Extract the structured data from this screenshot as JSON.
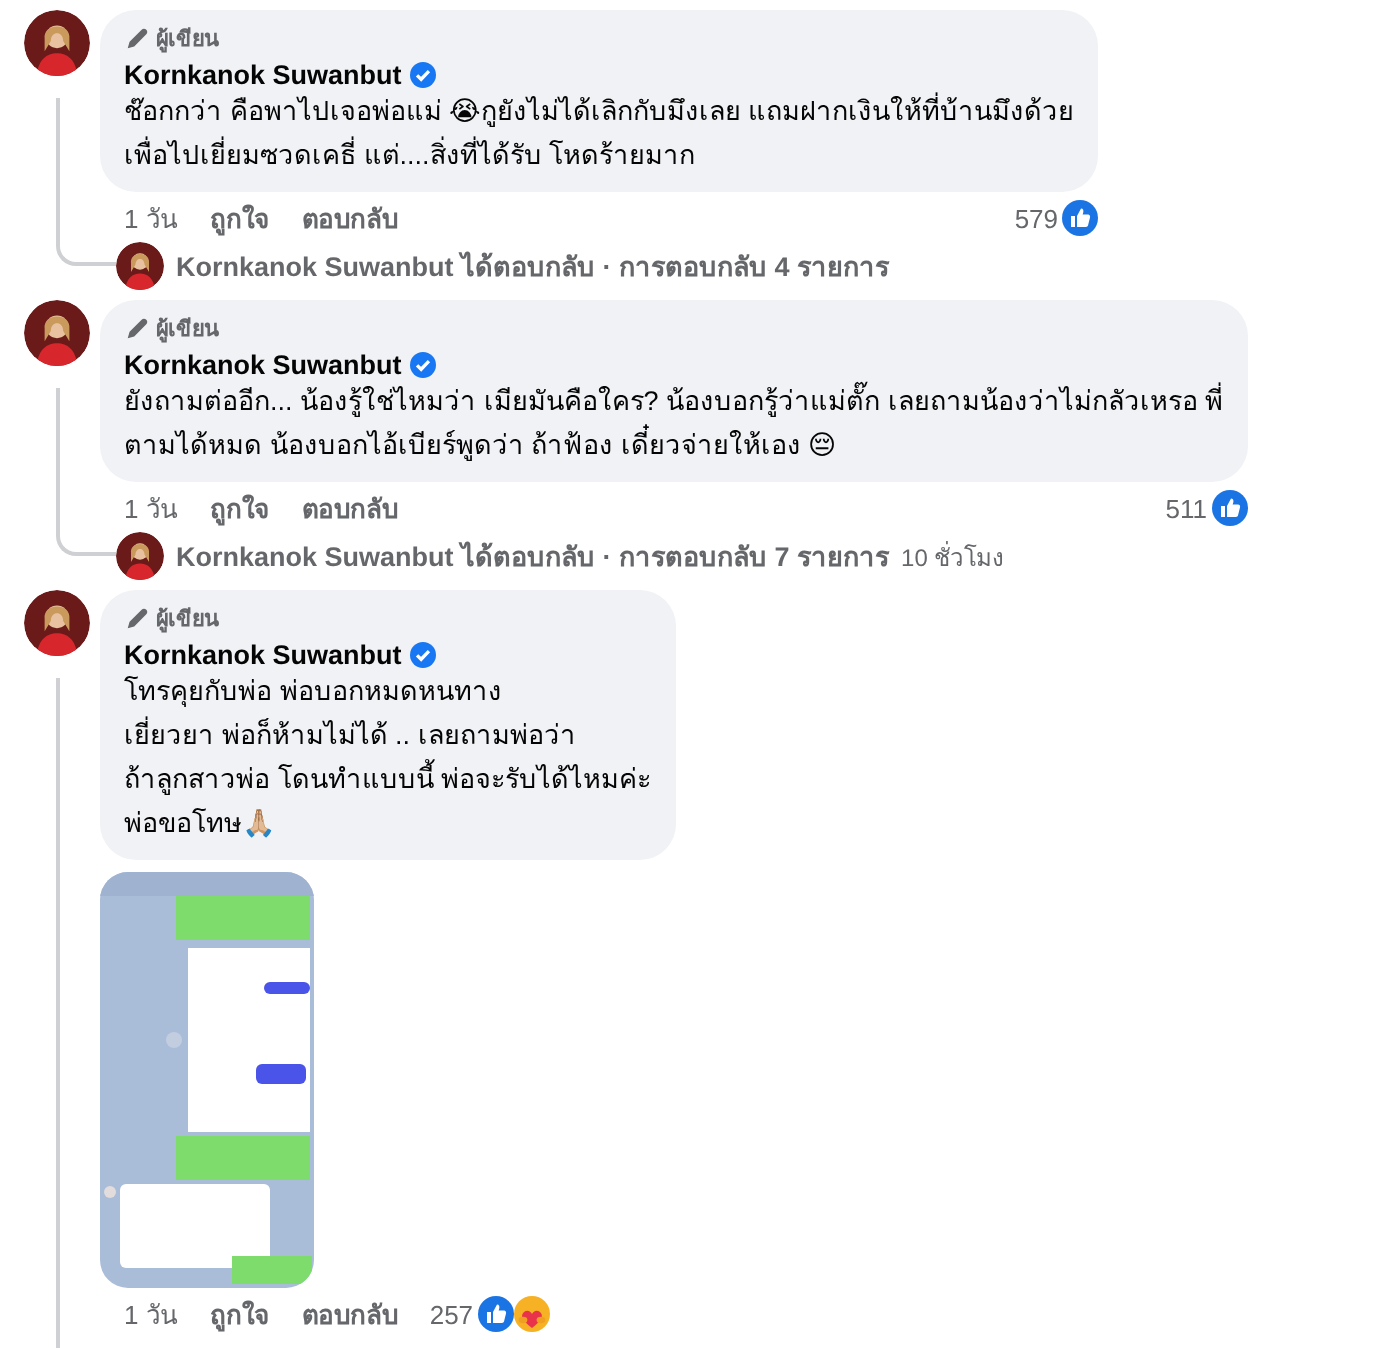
{
  "comments": [
    {
      "badge": "ผู้เขียน",
      "author": "Kornkanok Suwanbut",
      "verified": true,
      "text": "ช๊อกกว่า คือพาไปเจอพ่อแม่ 😭กูยังไม่ได้เลิกกับมึงเลย แถมฝากเงินให้ที่บ้านมึงด้วย\nเพื่อไปเยี่ยมซวดเคธี่ แต่....สิ่งที่ได้รับ โหดร้ายมาก",
      "time": "1 วัน",
      "like": "ถูกใจ",
      "reply": "ตอบกลับ",
      "reaction_count": "579",
      "reactions": [
        {
          "kind": "like"
        }
      ],
      "replies_summary": {
        "author": "Kornkanok Suwanbut",
        "text": "ได้ตอบกลับ · การตอบกลับ 4 รายการ"
      }
    },
    {
      "badge": "ผู้เขียน",
      "author": "Kornkanok Suwanbut",
      "verified": true,
      "text": "ยังถามต่ออีก... น้องรู้ใช่ไหมว่า เมียมันคือใคร? น้องบอกรู้ว่าแม่ตั๊ก เลยถามน้องว่าไม่กลัวเหรอ พี่\nตามได้หมด น้องบอกไอ้เบียร์พูดว่า ถ้าฟ้อง เดี๋ยวจ่ายให้เอง 😔",
      "time": "1 วัน",
      "like": "ถูกใจ",
      "reply": "ตอบกลับ",
      "reaction_count": "511",
      "reactions": [
        {
          "kind": "like"
        }
      ],
      "replies_summary": {
        "author": "Kornkanok Suwanbut",
        "text": "ได้ตอบกลับ · การตอบกลับ 7 รายการ",
        "time": "10 ชั่วโมง"
      }
    },
    {
      "badge": "ผู้เขียน",
      "author": "Kornkanok Suwanbut",
      "verified": true,
      "text": "โทรคุยกับพ่อ พ่อบอกหมดหนทาง\nเยี่ยวยา พ่อก็ห้ามไม่ได้ .. เลยถามพ่อว่า\nถ้าลูกสาวพ่อ โดนทำแบบนี้ พ่อจะรับได้ไหมค่ะ\nพ่อขอโทษ🙏🏼",
      "attachment": {
        "kind": "picture"
      },
      "time": "1 วัน",
      "like": "ถูกใจ",
      "reply": "ตอบกลับ",
      "reaction_count": "257",
      "reactions": [
        {
          "kind": "like"
        },
        {
          "kind": "care"
        }
      ]
    }
  ]
}
